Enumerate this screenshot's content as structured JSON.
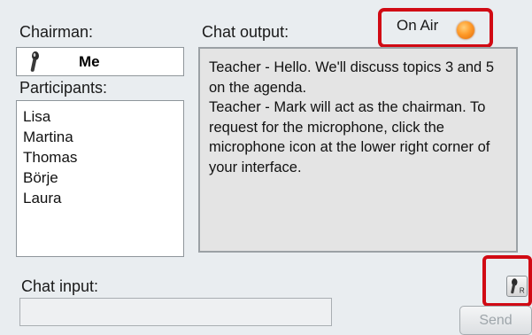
{
  "labels": {
    "chairman": "Chairman:",
    "participants": "Participants:",
    "chat_output": "Chat output:",
    "chat_input": "Chat input:"
  },
  "chairman_name": "Me",
  "participants": [
    "Lisa",
    "Martina",
    "Thomas",
    "Börje",
    "Laura"
  ],
  "on_air": {
    "label": "On Air",
    "light_color": "#ff9b2a"
  },
  "chat_messages": [
    "Teacher - Hello. We'll discuss topics 3 and 5 on the agenda.",
    "Teacher - Mark will act as the chairman. To request for the microphone, click the microphone icon at the lower right corner of your interface."
  ],
  "mic_request": {
    "icon": "microphone-icon",
    "badge": "R"
  },
  "chat_input": {
    "value": ""
  },
  "send_label": "Send",
  "colors": {
    "highlight": "#d10a14",
    "panel": "#e9edf0",
    "output_bg": "#e4e4e4"
  }
}
